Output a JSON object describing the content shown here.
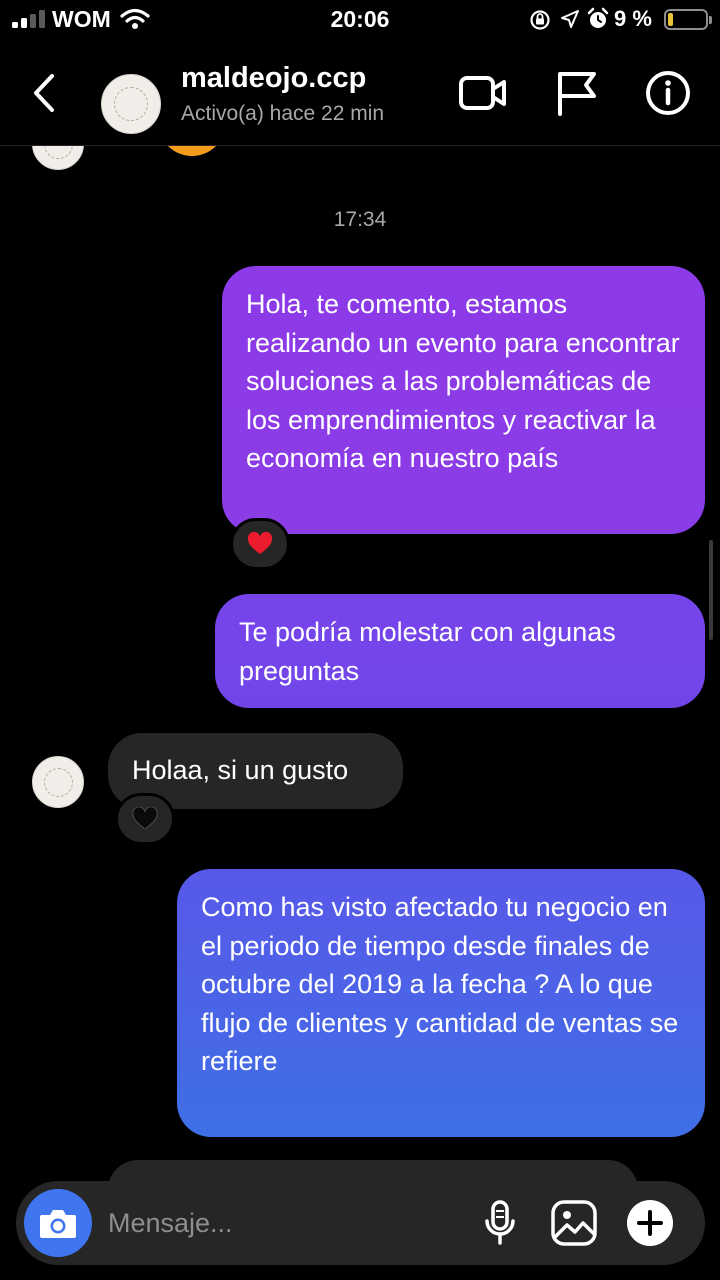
{
  "status_bar": {
    "carrier": "WOM",
    "time": "20:06",
    "battery_percent": "9 %",
    "battery_level": 0.09,
    "icons": [
      "signal-icon",
      "wifi-icon",
      "orientation-lock-icon",
      "location-icon",
      "alarm-icon",
      "battery-icon"
    ]
  },
  "header": {
    "username": "maldeojo.ccp",
    "active_status": "Activo(a) hace 22 min",
    "icons": [
      "back-chevron-icon",
      "video-call-icon",
      "flag-icon",
      "info-icon"
    ]
  },
  "chat": {
    "timestamp": "17:34",
    "messages": [
      {
        "direction": "sent",
        "text": "Hola, te comento, estamos realizando un evento para encontrar soluciones a las problemáticas de los emprendimientos y reactivar la economía en nuestro país",
        "reaction": "red-heart"
      },
      {
        "direction": "sent",
        "text": "Te podría molestar con algunas preguntas"
      },
      {
        "direction": "received",
        "text": "Holaa, si un gusto",
        "reaction": "black-heart"
      },
      {
        "direction": "sent",
        "text": "Como has visto afectado tu negocio en el periodo de tiempo desde finales de octubre del 2019 a la fecha ? A lo que flujo de clientes y cantidad de ventas se refiere"
      }
    ]
  },
  "composer": {
    "placeholder": "Mensaje...",
    "icons": [
      "camera-icon",
      "microphone-icon",
      "gallery-icon",
      "plus-icon"
    ]
  },
  "colors": {
    "background": "#000000",
    "received_bubble": "#262626",
    "sent_bubble_top": "#8d3ae8",
    "sent_bubble_bottom": "#3e6fe6",
    "camera_button": "#3f76f0",
    "secondary_text": "#a8a8a8"
  }
}
